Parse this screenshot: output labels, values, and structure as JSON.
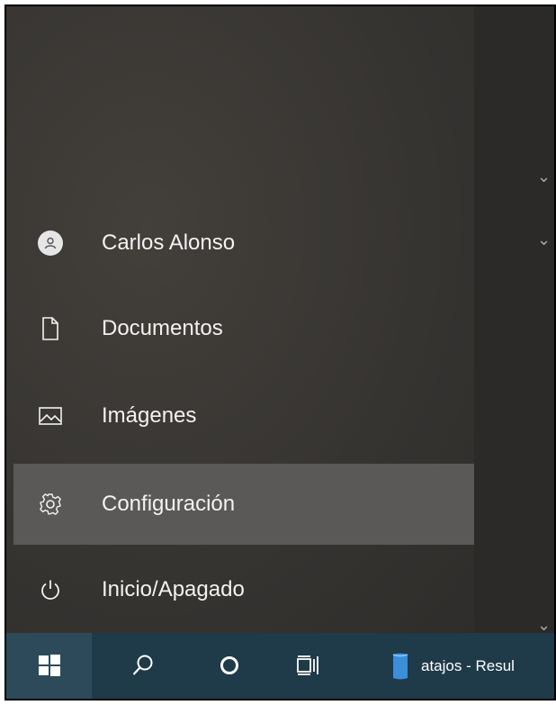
{
  "start_menu": {
    "items": [
      {
        "id": "user",
        "label": "Carlos Alonso",
        "icon": "user-avatar-icon"
      },
      {
        "id": "documents",
        "label": "Documentos",
        "icon": "document-icon"
      },
      {
        "id": "pictures",
        "label": "Imágenes",
        "icon": "picture-icon"
      },
      {
        "id": "settings",
        "label": "Configuración",
        "icon": "gear-icon"
      },
      {
        "id": "power",
        "label": "Inicio/Apagado",
        "icon": "power-icon"
      }
    ],
    "active_item": "settings"
  },
  "taskbar": {
    "buttons": [
      {
        "name": "start-button",
        "icon": "windows-logo-icon"
      },
      {
        "name": "search-button",
        "icon": "search-icon"
      },
      {
        "name": "cortana-button",
        "icon": "cortana-circle-icon"
      },
      {
        "name": "task-view-button",
        "icon": "task-view-icon"
      }
    ],
    "app": {
      "label": "atajos - Resul",
      "icon": "app-icon"
    }
  },
  "colors": {
    "taskbar": "#1f3a49",
    "active_item": "#5a5957",
    "accent_underline": "#7aa7c4"
  }
}
